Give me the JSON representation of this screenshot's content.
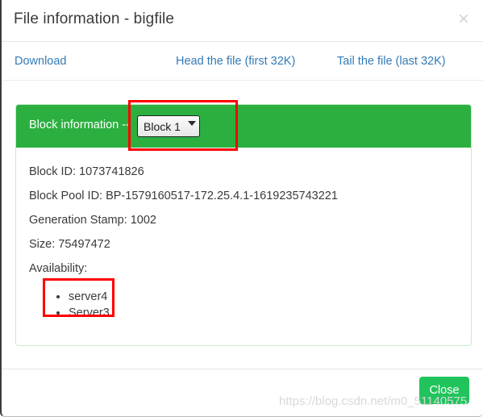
{
  "dialog": {
    "title": "File information - bigfile",
    "close_icon": "close-icon",
    "close_icon_glyph": "×"
  },
  "links": [
    {
      "label": "Download"
    },
    {
      "label": "Head the file (first 32K)"
    },
    {
      "label": "Tail the file (last 32K)"
    }
  ],
  "panel": {
    "heading_label": "Block information --",
    "block_select": {
      "selected": "Block 1",
      "options": [
        "Block 1"
      ],
      "chevron_icon": "chevron-down-icon"
    },
    "info": [
      "Block ID: 1073741826",
      "Block Pool ID: BP-1579160517-172.25.4.1-1619235743221",
      "Generation Stamp: 1002",
      "Size: 75497472",
      "Availability:"
    ],
    "availability": [
      "server4",
      "Server3"
    ]
  },
  "footer": {
    "close_label": "Close"
  },
  "watermark": "https://blog.csdn.net/m0_51140575",
  "colors": {
    "panel_green": "#2bb040",
    "button_green": "#21c45c",
    "link_blue": "#337ab7",
    "annotation_red": "#ff0000"
  }
}
